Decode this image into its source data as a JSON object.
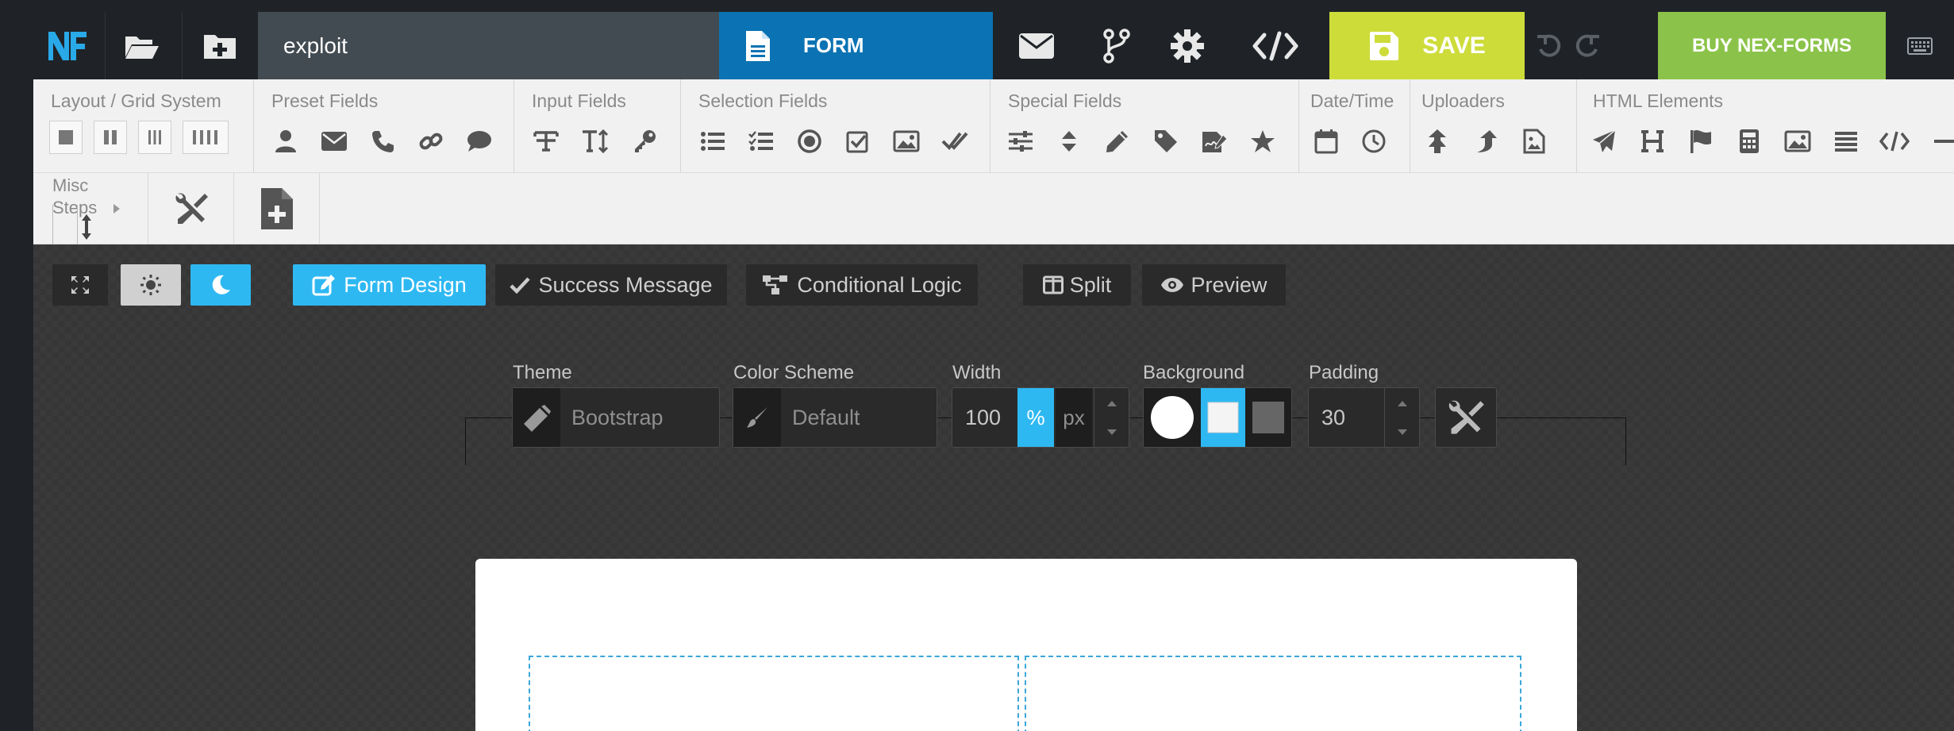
{
  "topbar": {
    "form_name": "exploit",
    "form_tab_label": "FORM",
    "save_label": "SAVE",
    "buy_label": "BUY NEX-FORMS"
  },
  "palette": {
    "groups": [
      {
        "label": "Layout / Grid System"
      },
      {
        "label": "Preset Fields"
      },
      {
        "label": "Input Fields"
      },
      {
        "label": "Selection Fields"
      },
      {
        "label": "Special Fields"
      },
      {
        "label": "Date/Time"
      },
      {
        "label": "Uploaders"
      },
      {
        "label": "HTML Elements"
      }
    ],
    "misc_label_1": "Misc",
    "misc_label_2": "Steps"
  },
  "toolbar": {
    "form_design": "Form Design",
    "success_message": "Success Message",
    "conditional_logic": "Conditional Logic",
    "split": "Split",
    "preview": "Preview"
  },
  "settings": {
    "theme_label": "Theme",
    "theme_value": "Bootstrap",
    "color_scheme_label": "Color Scheme",
    "color_scheme_value": "Default",
    "width_label": "Width",
    "width_value": "100",
    "width_unit_pct": "%",
    "width_unit_px": "px",
    "background_label": "Background",
    "padding_label": "Padding",
    "padding_value": "30"
  },
  "colors": {
    "accent_blue": "#2eb8f2",
    "form_tab_blue": "#0b73b3",
    "save_yellow_green": "#cddc39",
    "buy_green": "#8bc34a",
    "topbar_dark": "#1f2327"
  }
}
